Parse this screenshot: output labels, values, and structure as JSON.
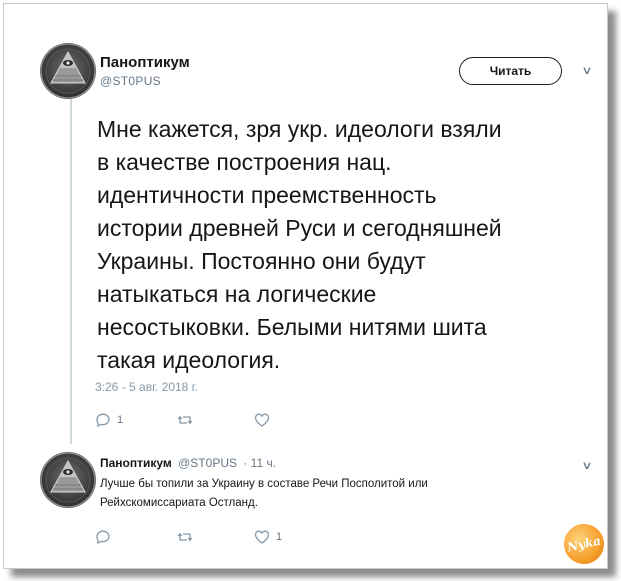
{
  "tweet": {
    "author_name": "Паноптикум",
    "author_handle": "@ST0PUS",
    "follow_label": "Читать",
    "text": "Мне кажется, зря укр. идеологи взяли\nв качестве построения нац.\nидентичности преемственность\nистории древней Руси и сегодняшней\nУкраины. Постоянно они будут\nнатыкаться на логические\nнесостыковки. Белыми нитями шита\nтакая идеология.",
    "timestamp": "3:26 - 5 авг. 2018 г.",
    "reply_count": "1",
    "retweet_count": "",
    "like_count": ""
  },
  "reply": {
    "author_name": "Паноптикум",
    "author_handle": "@ST0PUS",
    "time_ago": "· 11 ч.",
    "text": "Лучше бы топили за Украину в составе Речи Посполитой или\nРейхскомиссариата Остланд.",
    "reply_count": "",
    "retweet_count": "",
    "like_count": "1"
  },
  "watermark": {
    "text": "Nyka"
  },
  "colors": {
    "text": "#14171a",
    "secondary": "#657786",
    "muted": "#8899a6",
    "thread_line": "#cfd9de"
  },
  "icons": {
    "avatar": "all-seeing-eye-pyramid-icon",
    "menu": "chevron-down-icon",
    "reply": "reply-bubble-icon",
    "retweet": "retweet-icon",
    "like": "heart-icon"
  }
}
